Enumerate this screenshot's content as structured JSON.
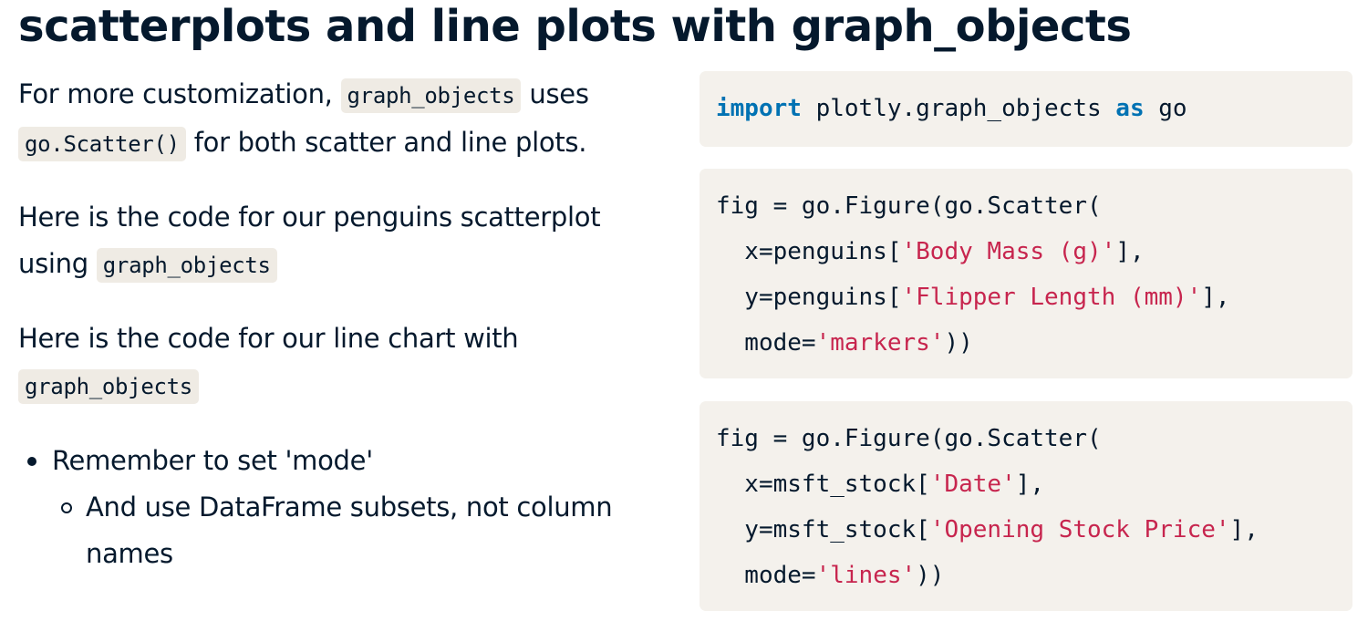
{
  "title": "scatterplots and line plots with graph_objects",
  "left": {
    "p1": {
      "t1": "For more customization, ",
      "code1": "graph_objects",
      "t2": " uses ",
      "code2": "go.Scatter()",
      "t3": " for both scatter and line plots."
    },
    "p2": {
      "t1": "Here is the code for our penguins scatterplot using ",
      "code1": "graph_objects"
    },
    "p3": {
      "t1": "Here is the code for our line chart with ",
      "code1": "graph_objects"
    },
    "bullets": [
      {
        "text": "Remember to set 'mode'",
        "sub": [
          "And use DataFrame subsets, not column names"
        ]
      }
    ]
  },
  "code": {
    "block1": {
      "kw_import": "import",
      "module": " plotly.graph_objects ",
      "kw_as": "as",
      "alias": " go"
    },
    "block2": {
      "line1": "fig = go.Figure(go.Scatter(",
      "line2_pre": "  x=penguins[",
      "line2_str": "'Body Mass (g)'",
      "line2_post": "],",
      "line3_pre": "  y=penguins[",
      "line3_str": "'Flipper Length (mm)'",
      "line3_post": "],",
      "line4_pre": "  mode=",
      "line4_str": "'markers'",
      "line4_post": "))"
    },
    "block3": {
      "line1": "fig = go.Figure(go.Scatter(",
      "line2_pre": "  x=msft_stock[",
      "line2_str": "'Date'",
      "line2_post": "],",
      "line3_pre": "  y=msft_stock[",
      "line3_str": "'Opening Stock Price'",
      "line3_post": "],",
      "line4_pre": "  mode=",
      "line4_str": "'lines'",
      "line4_post": "))"
    }
  },
  "colors": {
    "text": "#05192d",
    "keyword": "#0072b3",
    "string": "#c7254e",
    "code_bg": "#f4f1ec",
    "inline_code_bg": "#efebe4"
  }
}
